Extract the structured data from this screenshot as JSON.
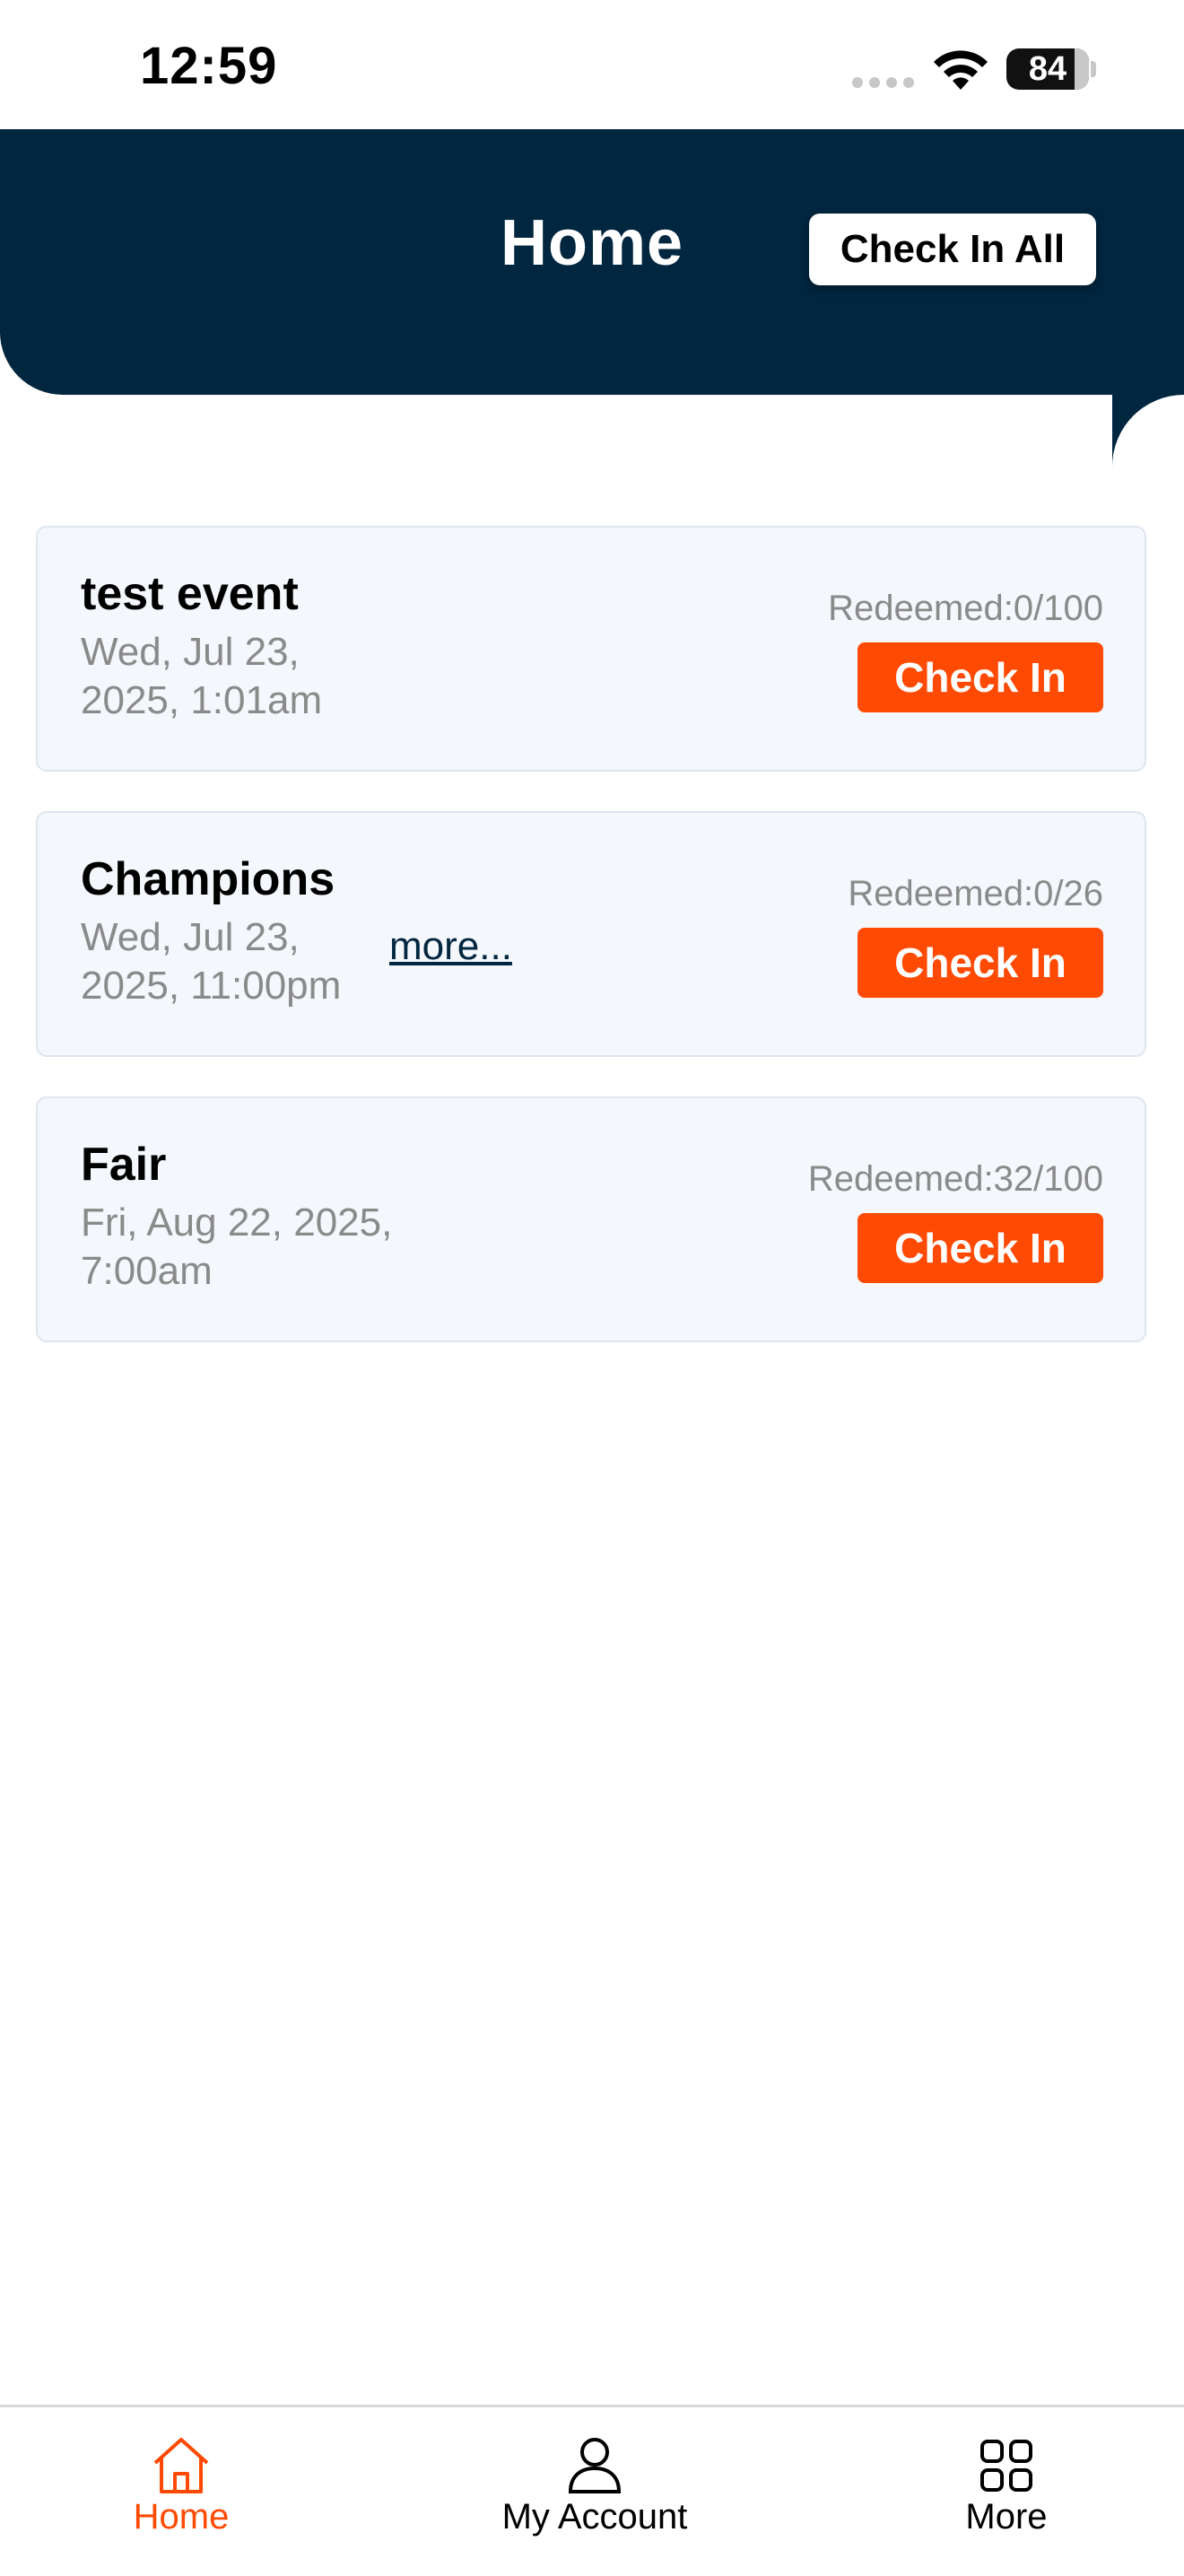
{
  "status_bar": {
    "time": "12:59",
    "battery": "84"
  },
  "header": {
    "title": "Home",
    "check_in_all_label": "Check In All"
  },
  "events": [
    {
      "title": "test event",
      "date": "Wed, Jul 23, 2025, 1:01am",
      "redeemed": "Redeemed:0/100",
      "button_label": "Check In",
      "more": ""
    },
    {
      "title": "Champions",
      "date": "Wed, Jul 23, 2025, 11:00pm",
      "redeemed": "Redeemed:0/26",
      "button_label": "Check In",
      "more": "more..."
    },
    {
      "title": "Fair",
      "date": "Fri, Aug 22, 2025, 7:00am",
      "redeemed": "Redeemed:32/100",
      "button_label": "Check In",
      "more": ""
    }
  ],
  "tabbar": {
    "items": [
      {
        "label": "Home",
        "icon": "home-icon",
        "active": true
      },
      {
        "label": "My Account",
        "icon": "user-icon",
        "active": false
      },
      {
        "label": "More",
        "icon": "grid-icon",
        "active": false
      }
    ]
  },
  "colors": {
    "header_bg": "#01263f",
    "accent": "#ff4a03",
    "card_bg": "#f4f7fb",
    "muted_text": "#8a8a8a"
  }
}
